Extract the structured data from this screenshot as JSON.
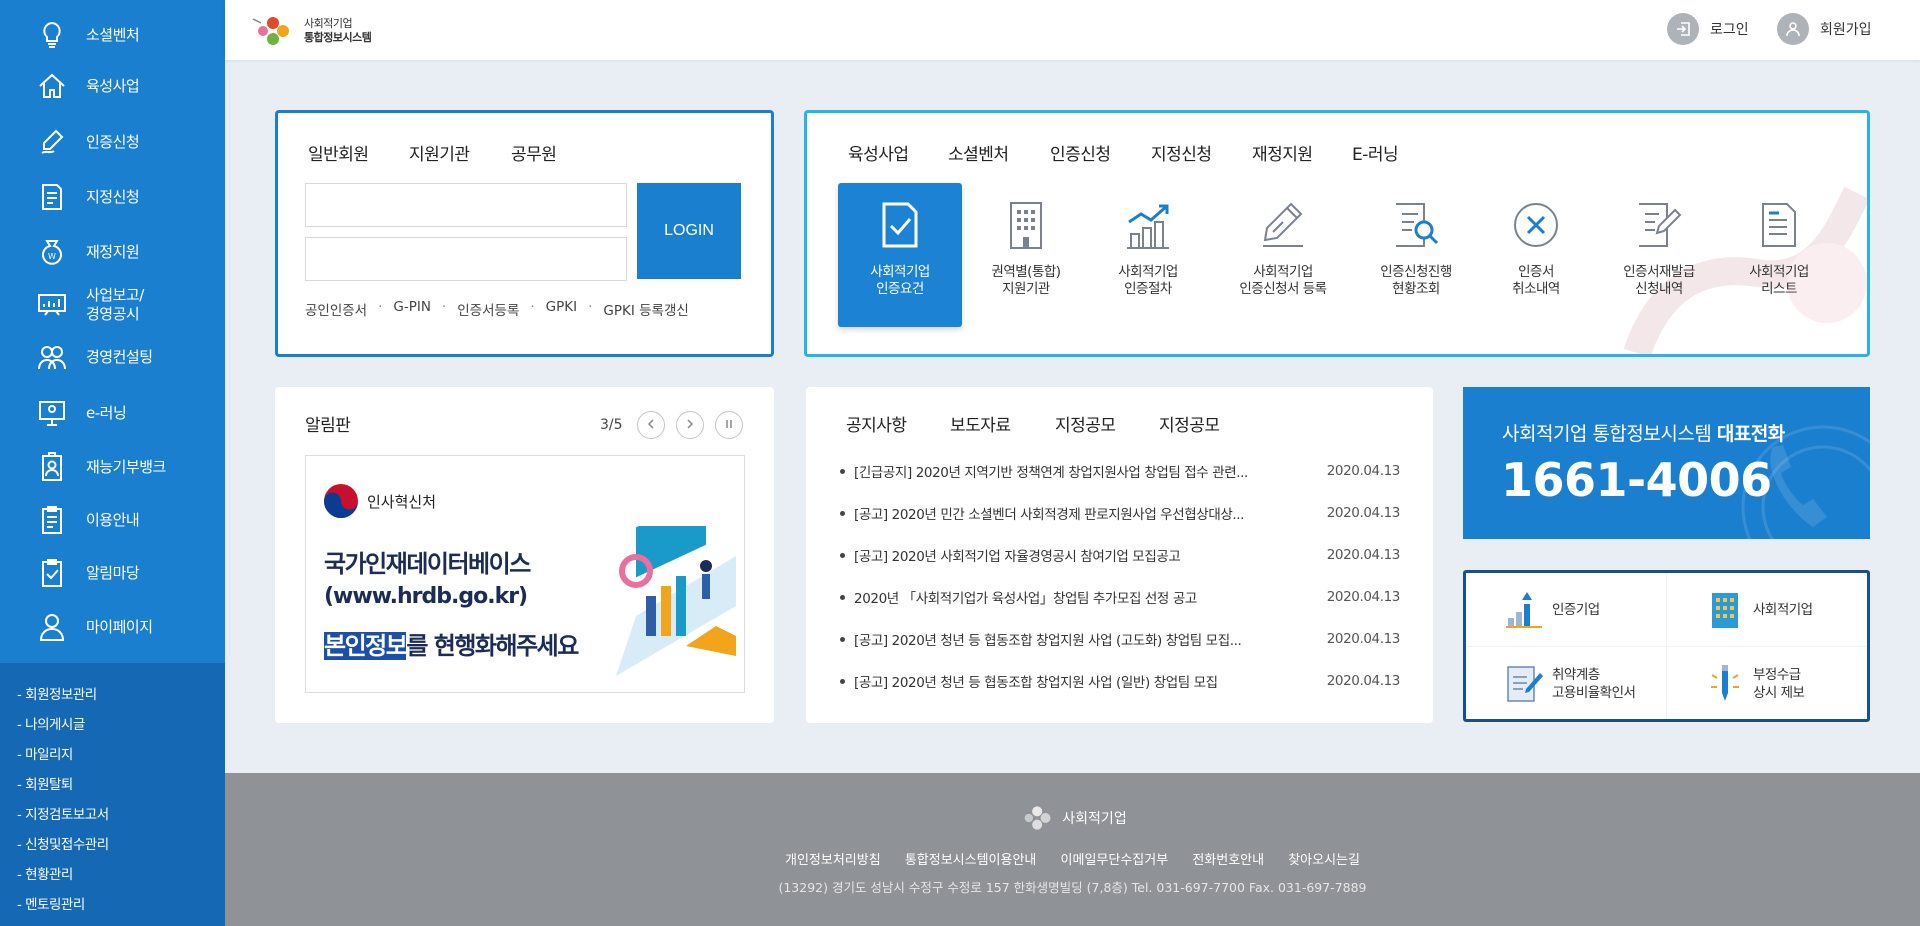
{
  "sidebar": {
    "items": [
      {
        "label": "소셜벤처"
      },
      {
        "label": "육성사업"
      },
      {
        "label": "인증신청"
      },
      {
        "label": "지정신청"
      },
      {
        "label": "재정지원"
      },
      {
        "label": "사업보고/\n경영공시"
      },
      {
        "label": "경영컨설팅"
      },
      {
        "label": "e-러닝"
      },
      {
        "label": "재능기부뱅크"
      },
      {
        "label": "이용안내"
      },
      {
        "label": "알림마당"
      },
      {
        "label": "마이페이지"
      }
    ],
    "sub_items": [
      {
        "label": "회원정보관리"
      },
      {
        "label": "나의게시글"
      },
      {
        "label": "마일리지"
      },
      {
        "label": "회원탈퇴"
      },
      {
        "label": "지정검토보고서"
      },
      {
        "label": "신청및접수관리"
      },
      {
        "label": "현황관리"
      },
      {
        "label": "멘토링관리"
      }
    ]
  },
  "header": {
    "logo_line1": "사회적기업",
    "logo_line2": "통합정보시스템",
    "login": "로그인",
    "signup": "회원가입"
  },
  "login_box": {
    "tabs": [
      {
        "label": "일반회원"
      },
      {
        "label": "지원기관"
      },
      {
        "label": "공무원"
      }
    ],
    "active_tab": "공무원",
    "id_value": "",
    "pw_value": "",
    "button": "LOGIN",
    "links": [
      {
        "label": "공인인증서"
      },
      {
        "label": "G-PIN"
      },
      {
        "label": "인증서등록"
      },
      {
        "label": "GPKI"
      },
      {
        "label": "GPKI 등록갱신"
      }
    ],
    "separator": "·"
  },
  "service_box": {
    "tabs": [
      {
        "label": "육성사업"
      },
      {
        "label": "소셜벤처"
      },
      {
        "label": "인증신청"
      },
      {
        "label": "지정신청"
      },
      {
        "label": "재정지원"
      },
      {
        "label": "E-러닝"
      }
    ],
    "active_tab": "인증신청",
    "items": [
      {
        "label": "사회적기업\n인증요건",
        "icon": "document-check-icon"
      },
      {
        "label": "권역별(통합)\n지원기관",
        "icon": "building-icon"
      },
      {
        "label": "사회적기업\n인증절차",
        "icon": "chart-growth-icon"
      },
      {
        "label": "사회적기업\n인증신청서 등록",
        "icon": "pencil-icon"
      },
      {
        "label": "인증신청진행\n현황조회",
        "icon": "document-search-icon"
      },
      {
        "label": "인증서\n취소내역",
        "icon": "cancel-circle-icon"
      },
      {
        "label": "인증서재발급\n신청내역",
        "icon": "document-edit-icon"
      },
      {
        "label": "사회적기업\n리스트",
        "icon": "document-list-icon"
      }
    ]
  },
  "board": {
    "title": "알림판",
    "page": "3/5",
    "banner": {
      "org": "인사혁신처",
      "line1": "국가인재데이터베이스",
      "line2": "(www.hrdb.go.kr)",
      "highlight": "본인정보",
      "rest": "를 현행화해주세요"
    }
  },
  "notices": {
    "tabs": [
      {
        "label": "공지사항"
      },
      {
        "label": "보도자료"
      },
      {
        "label": "지정공모"
      },
      {
        "label": "지정공모"
      }
    ],
    "active_tab": "공지사항",
    "rows": [
      {
        "title": "[긴급공지] 2020년 지역기반 정책연계 창업지원사업 창업팀 접수 관련...",
        "date": "2020.04.13"
      },
      {
        "title": "[공고] 2020년 민간 소셜벤더 사회적경제 판로지원사업 우선협상대상...",
        "date": "2020.04.13"
      },
      {
        "title": "[공고] 2020년 사회적기업 자율경영공시 참여기업 모집공고",
        "date": "2020.04.13"
      },
      {
        "title": "2020년 「사회적기업가 육성사업」창업팀 추가모집 선정 공고",
        "date": "2020.04.13"
      },
      {
        "title": "[공고] 2020년 청년 등 협동조합 창업지원 사업 (고도화) 창업팀 모집...",
        "date": "2020.04.13"
      },
      {
        "title": "[공고] 2020년 청년 등 협동조합 창업지원 사업 (일반) 창업팀 모집",
        "date": "2020.04.13"
      }
    ]
  },
  "phone": {
    "caption": "사회적기업 통합정보시스템",
    "caption_bold": "대표전화",
    "number": "1661-4006"
  },
  "quick": [
    {
      "label": "인증기업"
    },
    {
      "label": "사회적기업"
    },
    {
      "label": "취약계층\n고용비율확인서"
    },
    {
      "label": "부정수급\n상시 제보"
    }
  ],
  "footer": {
    "logo": "사회적기업",
    "links": [
      {
        "label": "개인정보처리방침"
      },
      {
        "label": "통합정보시스템이용안내"
      },
      {
        "label": "이메일무단수집거부"
      },
      {
        "label": "전화번호안내"
      },
      {
        "label": "찾아오시는길"
      }
    ],
    "address": "(13292) 경기도 성남시 수정구 수정로 157 한화생명빌딩 (7,8층) Tel. 031-697-7700 Fax. 031-697-7889"
  },
  "colors": {
    "primary": "#1b7fd0",
    "sidebar_sub": "#1569b4",
    "accent_cyan": "#26b5e6",
    "footer": "#8f9297"
  }
}
